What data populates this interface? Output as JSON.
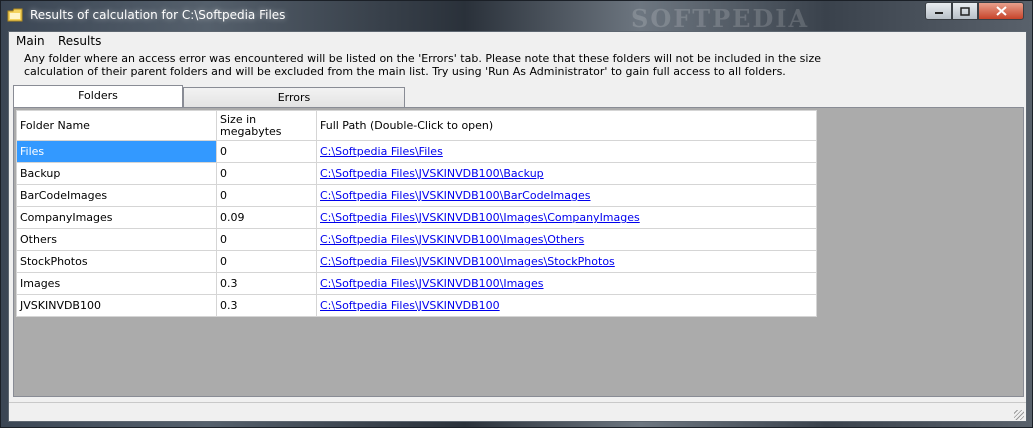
{
  "window": {
    "title": "Results of calculation for C:\\Softpedia Files",
    "watermark": "SOFTPEDIA"
  },
  "menu": {
    "main": "Main",
    "results": "Results"
  },
  "info_text": "Any folder where an access error was encountered will be listed on the 'Errors' tab. Please note that these folders will not be included in the size calculation of their parent folders and will be excluded from the main list. Try using 'Run As Administrator' to gain full access to all folders.",
  "tabs": {
    "folders": "Folders",
    "errors": "Errors"
  },
  "grid": {
    "headers": {
      "name": "Folder Name",
      "size_line1": "Size in",
      "size_line2": "megabytes",
      "path": "Full Path  (Double-Click to open)"
    },
    "rows": [
      {
        "name": "Files",
        "size": "0",
        "path": "C:\\Softpedia Files\\Files"
      },
      {
        "name": "Backup",
        "size": "0",
        "path": "C:\\Softpedia Files\\JVSKINVDB100\\Backup"
      },
      {
        "name": "BarCodeImages",
        "size": "0",
        "path": "C:\\Softpedia Files\\JVSKINVDB100\\BarCodeImages"
      },
      {
        "name": "CompanyImages",
        "size": "0.09",
        "path": "C:\\Softpedia Files\\JVSKINVDB100\\Images\\CompanyImages"
      },
      {
        "name": "Others",
        "size": "0",
        "path": "C:\\Softpedia Files\\JVSKINVDB100\\Images\\Others"
      },
      {
        "name": "StockPhotos",
        "size": "0",
        "path": "C:\\Softpedia Files\\JVSKINVDB100\\Images\\StockPhotos"
      },
      {
        "name": "Images",
        "size": "0.3",
        "path": "C:\\Softpedia Files\\JVSKINVDB100\\Images"
      },
      {
        "name": "JVSKINVDB100",
        "size": "0.3",
        "path": "C:\\Softpedia Files\\JVSKINVDB100"
      }
    ]
  },
  "icons": {
    "app": "folder-icon",
    "minimize": "minimize-icon",
    "maximize": "maximize-icon",
    "close": "close-icon"
  },
  "colors": {
    "selection": "#3399ff",
    "link": "#0000ee"
  }
}
